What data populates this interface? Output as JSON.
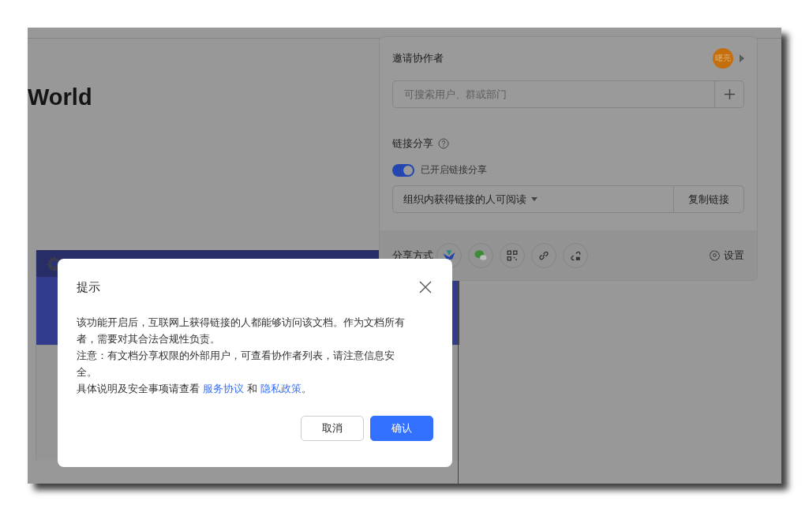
{
  "document": {
    "heading": "World"
  },
  "share_panel": {
    "title": "邀请协作者",
    "avatar": "曙亮",
    "search": {
      "placeholder": "可搜索用户、群或部门"
    },
    "link_share": {
      "label": "链接分享",
      "toggle": {
        "label": "已开启链接分享",
        "on": true
      },
      "permission": "组织内获得链接的人可阅读",
      "copy_button": "复制链接"
    },
    "share_methods": {
      "label": "分享方式",
      "items": [
        {
          "kind": "app"
        },
        {
          "kind": "chat"
        },
        {
          "kind": "qrcode"
        },
        {
          "kind": "link"
        },
        {
          "kind": "lock-link"
        }
      ]
    },
    "settings": "设置"
  },
  "dialog": {
    "title": "提示",
    "paragraphs": [
      {
        "parts": [
          {
            "kind": "text",
            "text": "该功能开启后，互联网上获得链接的人都能够访问该文档。作为文档所有者，需要对其合法合规性负责。"
          }
        ]
      },
      {
        "parts": [
          {
            "kind": "text",
            "text": "注意：有文档分享权限的外部用户，可查看协作者列表，请注意信息安全。"
          }
        ]
      },
      {
        "parts": [
          {
            "kind": "text",
            "text": "具体说明及安全事项请查看 "
          },
          {
            "kind": "link",
            "text": "服务协议"
          },
          {
            "kind": "text",
            "text": " 和 "
          },
          {
            "kind": "link",
            "text": "隐私政策"
          },
          {
            "kind": "text",
            "text": "。"
          }
        ]
      }
    ],
    "buttons": [
      {
        "label": "取消",
        "primary": false
      },
      {
        "label": "确认",
        "primary": true
      }
    ]
  }
}
